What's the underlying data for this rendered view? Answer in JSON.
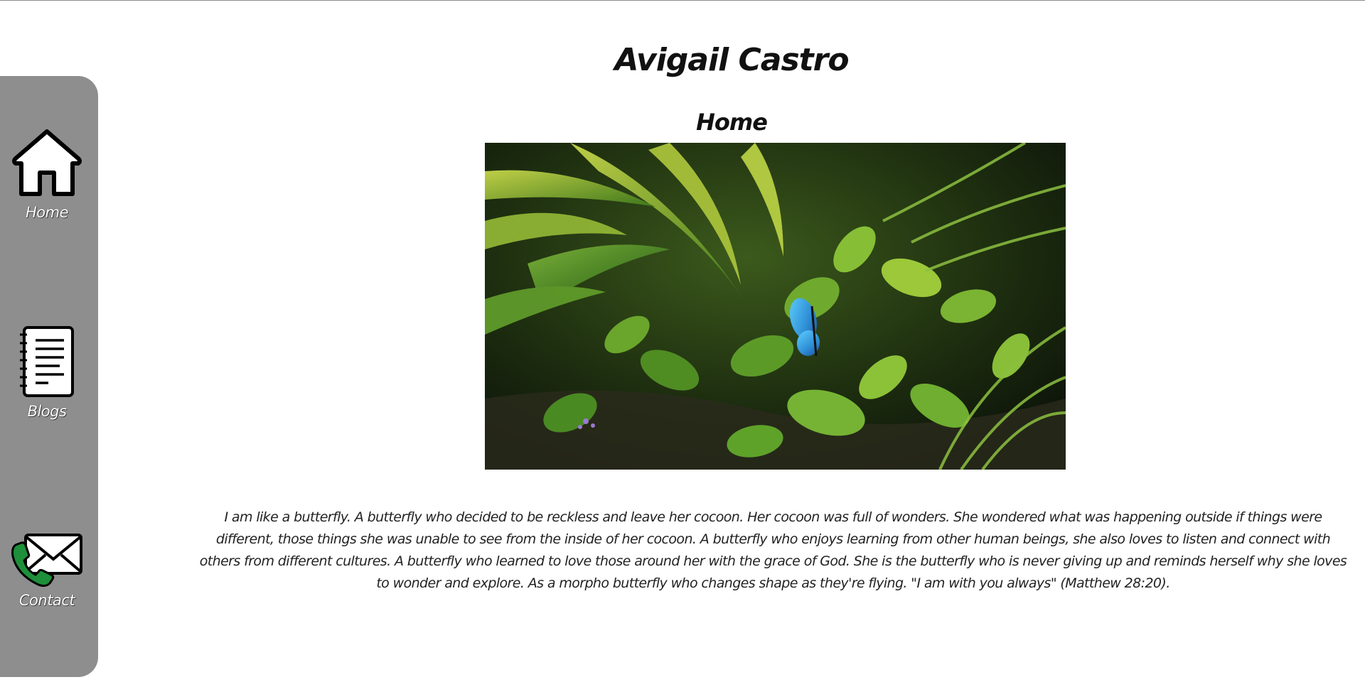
{
  "site": {
    "author_name": "Avigail Castro",
    "page_title": "Home"
  },
  "sidebar": {
    "items": [
      {
        "label": "Home",
        "icon": "home-icon"
      },
      {
        "label": "Blogs",
        "icon": "notebook-icon"
      },
      {
        "label": "Contact",
        "icon": "phone-mail-icon"
      }
    ]
  },
  "hero": {
    "subject": "blue-morpho-butterfly-on-green-foliage"
  },
  "bio": {
    "text": "I am like a butterfly. A butterfly who decided to be reckless and leave her cocoon. Her cocoon was full of wonders. She wondered what was happening outside if things were different, those things she was unable to see from the inside of her cocoon. A butterfly who enjoys learning from other human beings, she also loves to listen and connect with others from different cultures. A butterfly who learned to love those around her with the grace of God. She is the butterfly who is never giving up and reminds herself why she loves to wonder and explore. As a morpho butterfly who changes shape as they're flying. \"I am with you always\" (Matthew 28:20)."
  },
  "colors": {
    "sidebar_bg": "#8e8e8e",
    "contact_phone_green": "#1e8f3a",
    "butterfly_blue": "#2f9de0"
  }
}
